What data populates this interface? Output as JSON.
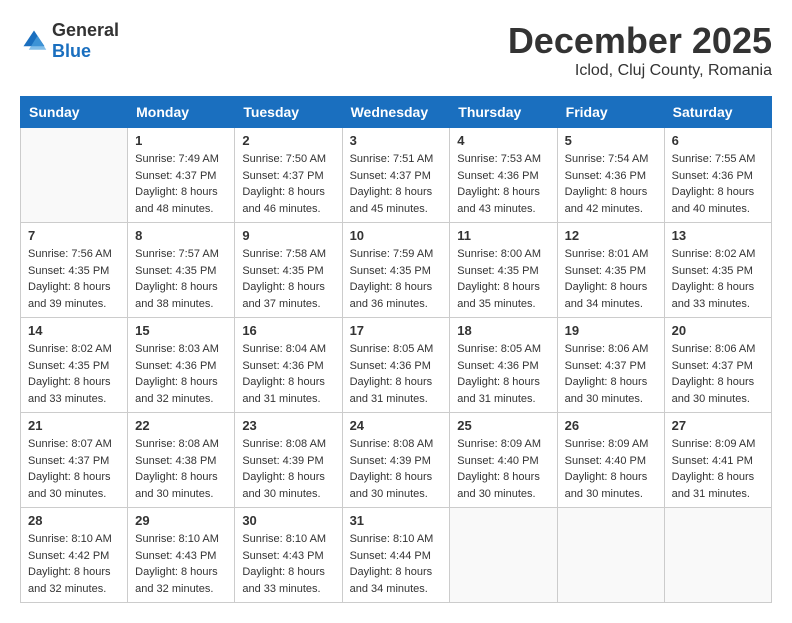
{
  "header": {
    "logo_general": "General",
    "logo_blue": "Blue",
    "month_title": "December 2025",
    "location": "Iclod, Cluj County, Romania"
  },
  "days_of_week": [
    "Sunday",
    "Monday",
    "Tuesday",
    "Wednesday",
    "Thursday",
    "Friday",
    "Saturday"
  ],
  "weeks": [
    [
      {
        "day": "",
        "info": ""
      },
      {
        "day": "1",
        "info": "Sunrise: 7:49 AM\nSunset: 4:37 PM\nDaylight: 8 hours and 48 minutes."
      },
      {
        "day": "2",
        "info": "Sunrise: 7:50 AM\nSunset: 4:37 PM\nDaylight: 8 hours and 46 minutes."
      },
      {
        "day": "3",
        "info": "Sunrise: 7:51 AM\nSunset: 4:37 PM\nDaylight: 8 hours and 45 minutes."
      },
      {
        "day": "4",
        "info": "Sunrise: 7:53 AM\nSunset: 4:36 PM\nDaylight: 8 hours and 43 minutes."
      },
      {
        "day": "5",
        "info": "Sunrise: 7:54 AM\nSunset: 4:36 PM\nDaylight: 8 hours and 42 minutes."
      },
      {
        "day": "6",
        "info": "Sunrise: 7:55 AM\nSunset: 4:36 PM\nDaylight: 8 hours and 40 minutes."
      }
    ],
    [
      {
        "day": "7",
        "info": "Sunrise: 7:56 AM\nSunset: 4:35 PM\nDaylight: 8 hours and 39 minutes."
      },
      {
        "day": "8",
        "info": "Sunrise: 7:57 AM\nSunset: 4:35 PM\nDaylight: 8 hours and 38 minutes."
      },
      {
        "day": "9",
        "info": "Sunrise: 7:58 AM\nSunset: 4:35 PM\nDaylight: 8 hours and 37 minutes."
      },
      {
        "day": "10",
        "info": "Sunrise: 7:59 AM\nSunset: 4:35 PM\nDaylight: 8 hours and 36 minutes."
      },
      {
        "day": "11",
        "info": "Sunrise: 8:00 AM\nSunset: 4:35 PM\nDaylight: 8 hours and 35 minutes."
      },
      {
        "day": "12",
        "info": "Sunrise: 8:01 AM\nSunset: 4:35 PM\nDaylight: 8 hours and 34 minutes."
      },
      {
        "day": "13",
        "info": "Sunrise: 8:02 AM\nSunset: 4:35 PM\nDaylight: 8 hours and 33 minutes."
      }
    ],
    [
      {
        "day": "14",
        "info": "Sunrise: 8:02 AM\nSunset: 4:35 PM\nDaylight: 8 hours and 33 minutes."
      },
      {
        "day": "15",
        "info": "Sunrise: 8:03 AM\nSunset: 4:36 PM\nDaylight: 8 hours and 32 minutes."
      },
      {
        "day": "16",
        "info": "Sunrise: 8:04 AM\nSunset: 4:36 PM\nDaylight: 8 hours and 31 minutes."
      },
      {
        "day": "17",
        "info": "Sunrise: 8:05 AM\nSunset: 4:36 PM\nDaylight: 8 hours and 31 minutes."
      },
      {
        "day": "18",
        "info": "Sunrise: 8:05 AM\nSunset: 4:36 PM\nDaylight: 8 hours and 31 minutes."
      },
      {
        "day": "19",
        "info": "Sunrise: 8:06 AM\nSunset: 4:37 PM\nDaylight: 8 hours and 30 minutes."
      },
      {
        "day": "20",
        "info": "Sunrise: 8:06 AM\nSunset: 4:37 PM\nDaylight: 8 hours and 30 minutes."
      }
    ],
    [
      {
        "day": "21",
        "info": "Sunrise: 8:07 AM\nSunset: 4:37 PM\nDaylight: 8 hours and 30 minutes."
      },
      {
        "day": "22",
        "info": "Sunrise: 8:08 AM\nSunset: 4:38 PM\nDaylight: 8 hours and 30 minutes."
      },
      {
        "day": "23",
        "info": "Sunrise: 8:08 AM\nSunset: 4:39 PM\nDaylight: 8 hours and 30 minutes."
      },
      {
        "day": "24",
        "info": "Sunrise: 8:08 AM\nSunset: 4:39 PM\nDaylight: 8 hours and 30 minutes."
      },
      {
        "day": "25",
        "info": "Sunrise: 8:09 AM\nSunset: 4:40 PM\nDaylight: 8 hours and 30 minutes."
      },
      {
        "day": "26",
        "info": "Sunrise: 8:09 AM\nSunset: 4:40 PM\nDaylight: 8 hours and 30 minutes."
      },
      {
        "day": "27",
        "info": "Sunrise: 8:09 AM\nSunset: 4:41 PM\nDaylight: 8 hours and 31 minutes."
      }
    ],
    [
      {
        "day": "28",
        "info": "Sunrise: 8:10 AM\nSunset: 4:42 PM\nDaylight: 8 hours and 32 minutes."
      },
      {
        "day": "29",
        "info": "Sunrise: 8:10 AM\nSunset: 4:43 PM\nDaylight: 8 hours and 32 minutes."
      },
      {
        "day": "30",
        "info": "Sunrise: 8:10 AM\nSunset: 4:43 PM\nDaylight: 8 hours and 33 minutes."
      },
      {
        "day": "31",
        "info": "Sunrise: 8:10 AM\nSunset: 4:44 PM\nDaylight: 8 hours and 34 minutes."
      },
      {
        "day": "",
        "info": ""
      },
      {
        "day": "",
        "info": ""
      },
      {
        "day": "",
        "info": ""
      }
    ]
  ]
}
